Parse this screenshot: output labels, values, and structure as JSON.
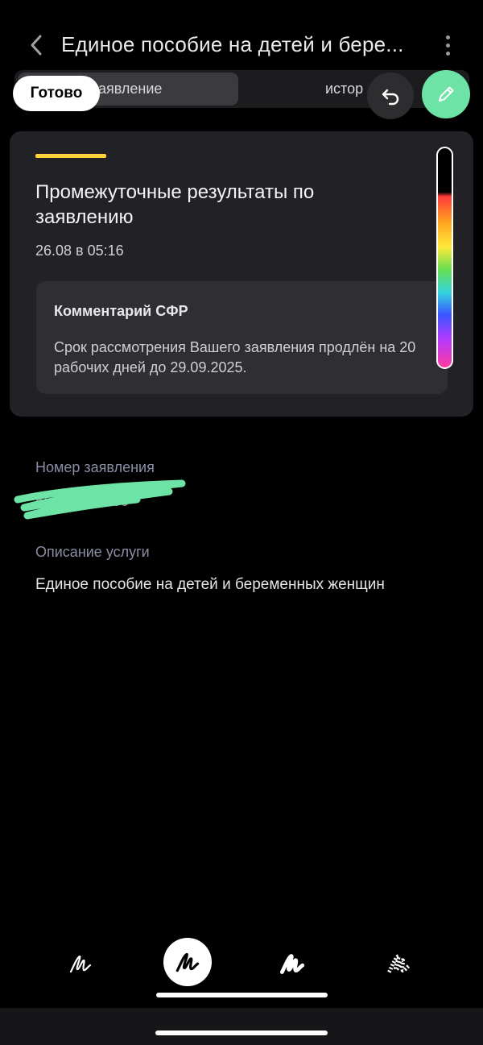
{
  "header": {
    "title": "Единое пособие на детей и бере...",
    "back_icon": "chevron-left-icon",
    "more_icon": "more-vertical-icon"
  },
  "tabs": [
    {
      "label": "аявление",
      "active": true
    },
    {
      "label": "истор",
      "active": false
    }
  ],
  "markup_toolbar": {
    "done_label": "Готово",
    "undo_icon": "undo-icon",
    "pen_icon": "pencil-icon",
    "pen_color": "#6ee3a6"
  },
  "card": {
    "accent_color": "#ffd23a",
    "title": "Промежуточные результаты по заявлению",
    "date": "26.08 в 05:16",
    "comment": {
      "title": "Комментарий СФР",
      "text": "Срок рассмотрения Вашего заявления продлён на 20 рабочих дней до 29.09.2025."
    }
  },
  "fields": {
    "number_label": "Номер заявления",
    "number_value": "5505?????30",
    "description_label": "Описание услуги",
    "description_value": "Единое пособие на детей и беременных женщин"
  },
  "drawing_tools": [
    {
      "icon": "pen-tool-icon",
      "selected": false
    },
    {
      "icon": "marker-tool-icon",
      "selected": true
    },
    {
      "icon": "brush-tool-icon",
      "selected": false
    },
    {
      "icon": "pixel-tool-icon",
      "selected": false
    }
  ]
}
